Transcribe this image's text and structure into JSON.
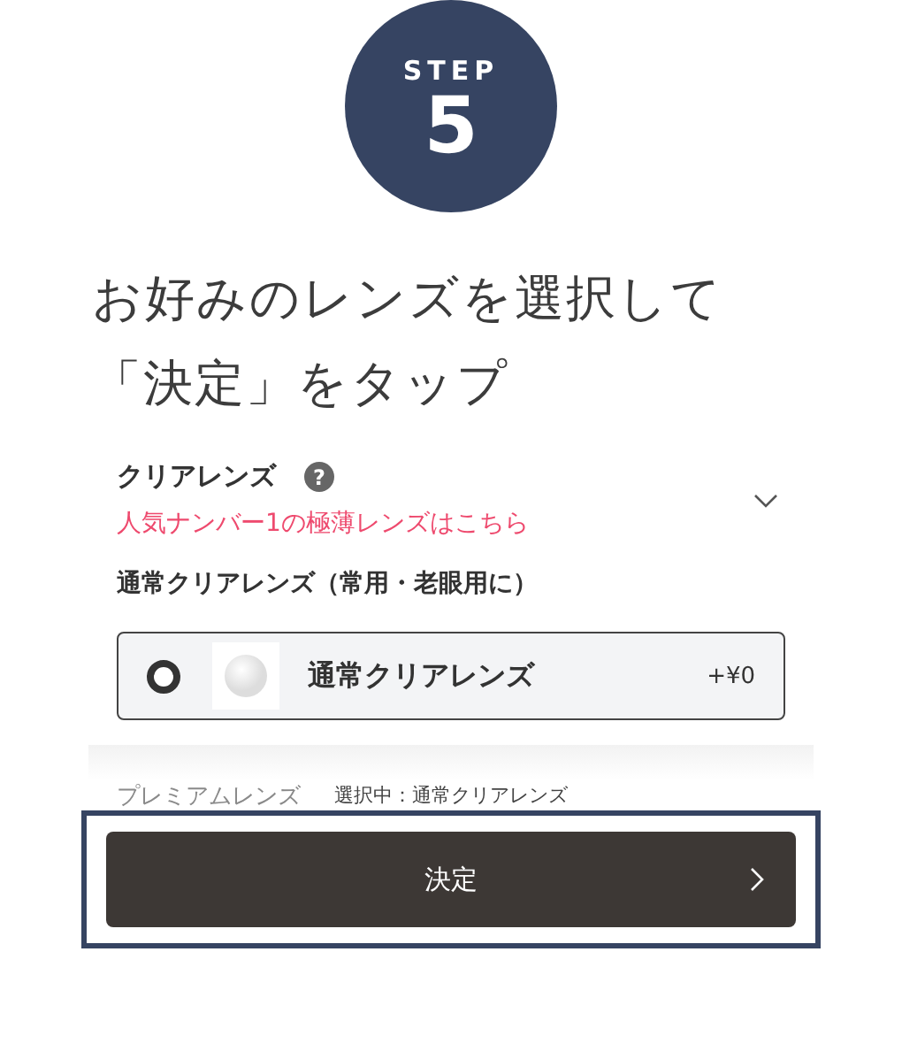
{
  "step": {
    "label": "STEP",
    "number": "5"
  },
  "title": [
    "お好みのレンズを選択して",
    "「決定」をタップ"
  ],
  "section": {
    "title": "クリアレンズ",
    "help": "?",
    "subtitle": "人気ナンバー1の極薄レンズはこちら",
    "expanded": true
  },
  "group": {
    "title": "通常クリアレンズ（常用・老眼用に）"
  },
  "options": [
    {
      "name": "通常クリアレンズ",
      "price": "+¥0",
      "selected": true
    }
  ],
  "faded_heading": "プレミアムレンズ",
  "footer": {
    "selection": "選択中：通常クリアレンズ",
    "button": "決定"
  }
}
